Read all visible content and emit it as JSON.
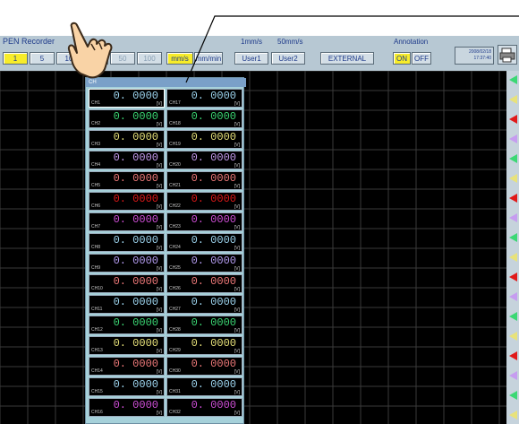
{
  "toolbar": {
    "title": "PEN Recorder",
    "range_buttons": [
      "1",
      "5",
      "10",
      "",
      "50",
      "100"
    ],
    "unit_buttons": [
      "mm/s",
      "mm/min"
    ],
    "speed_labels": [
      "1mm/s",
      "50mm/s"
    ],
    "user_buttons": [
      "User1",
      "User2"
    ],
    "external_label": "EXTERNAL",
    "annotation_label": "Annotation",
    "on_label": "ON",
    "off_label": "OFF",
    "date": "2008/02/18",
    "time": "17:37:40"
  },
  "panel": {
    "title": "CH",
    "channels": [
      {
        "name": "CH1",
        "value": "0. 0000",
        "unit": "[V]",
        "color": "#9ed6f0"
      },
      {
        "name": "CH17",
        "value": "0. 0000",
        "unit": "[V]",
        "color": "#9ed6f0"
      },
      {
        "name": "CH2",
        "value": "0. 0000",
        "unit": "[V]",
        "color": "#3bd874"
      },
      {
        "name": "CH18",
        "value": "0. 0000",
        "unit": "[V]",
        "color": "#3bd874"
      },
      {
        "name": "CH3",
        "value": "0. 0000",
        "unit": "[V]",
        "color": "#e8e27a"
      },
      {
        "name": "CH19",
        "value": "0. 0000",
        "unit": "[V]",
        "color": "#e8e27a"
      },
      {
        "name": "CH4",
        "value": "0. 0000",
        "unit": "[V]",
        "color": "#c69cf0"
      },
      {
        "name": "CH20",
        "value": "0. 0000",
        "unit": "[V]",
        "color": "#c69cf0"
      },
      {
        "name": "CH5",
        "value": "0. 0000",
        "unit": "[V]",
        "color": "#f07a7a"
      },
      {
        "name": "CH21",
        "value": "0. 0000",
        "unit": "[V]",
        "color": "#f07a7a"
      },
      {
        "name": "CH6",
        "value": "0. 0000",
        "unit": "[V]",
        "color": "#e11919"
      },
      {
        "name": "CH22",
        "value": "0. 0000",
        "unit": "[V]",
        "color": "#e11919"
      },
      {
        "name": "CH7",
        "value": "0. 0000",
        "unit": "[V]",
        "color": "#d04fd8"
      },
      {
        "name": "CH23",
        "value": "0. 0000",
        "unit": "[V]",
        "color": "#d04fd8"
      },
      {
        "name": "CH8",
        "value": "0. 0000",
        "unit": "[V]",
        "color": "#9ed6f0"
      },
      {
        "name": "CH24",
        "value": "0. 0000",
        "unit": "[V]",
        "color": "#9ed6f0"
      },
      {
        "name": "CH9",
        "value": "0. 0000",
        "unit": "[V]",
        "color": "#b49cf0"
      },
      {
        "name": "CH25",
        "value": "0. 0000",
        "unit": "[V]",
        "color": "#b49cf0"
      },
      {
        "name": "CH10",
        "value": "0. 0000",
        "unit": "[V]",
        "color": "#f07a7a"
      },
      {
        "name": "CH26",
        "value": "0. 0000",
        "unit": "[V]",
        "color": "#f07a7a"
      },
      {
        "name": "CH11",
        "value": "0. 0000",
        "unit": "[V]",
        "color": "#9ed6f0"
      },
      {
        "name": "CH27",
        "value": "0. 0000",
        "unit": "[V]",
        "color": "#9ed6f0"
      },
      {
        "name": "CH12",
        "value": "0. 0000",
        "unit": "[V]",
        "color": "#3bd874"
      },
      {
        "name": "CH28",
        "value": "0. 0000",
        "unit": "[V]",
        "color": "#3bd874"
      },
      {
        "name": "CH13",
        "value": "0. 0000",
        "unit": "[V]",
        "color": "#e8e27a"
      },
      {
        "name": "CH29",
        "value": "0. 0000",
        "unit": "[V]",
        "color": "#e8e27a"
      },
      {
        "name": "CH14",
        "value": "0. 0000",
        "unit": "[V]",
        "color": "#f07a7a"
      },
      {
        "name": "CH30",
        "value": "0. 0000",
        "unit": "[V]",
        "color": "#f07a7a"
      },
      {
        "name": "CH15",
        "value": "0. 0000",
        "unit": "[V]",
        "color": "#9ed6f0"
      },
      {
        "name": "CH31",
        "value": "0. 0000",
        "unit": "[V]",
        "color": "#9ed6f0"
      },
      {
        "name": "CH16",
        "value": "0. 0000",
        "unit": "[V]",
        "color": "#d04fd8"
      },
      {
        "name": "CH32",
        "value": "0. 0000",
        "unit": "[V]",
        "color": "#d04fd8"
      }
    ]
  },
  "markers": {
    "colors": [
      "#3bd874",
      "#e8e27a",
      "#e11919",
      "#c69cf0",
      "#3bd874",
      "#e8e27a",
      "#e11919",
      "#c69cf0",
      "#3bd874",
      "#e8e27a",
      "#e11919",
      "#c69cf0",
      "#3bd874",
      "#e8e27a",
      "#e11919",
      "#c69cf0",
      "#3bd874",
      "#e8e27a"
    ]
  }
}
